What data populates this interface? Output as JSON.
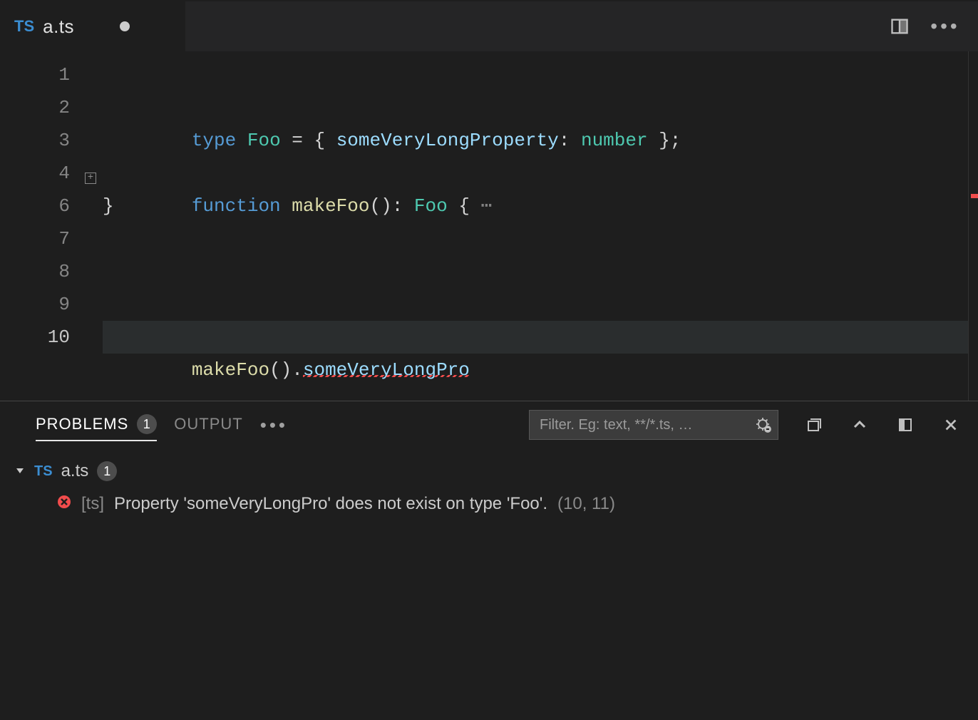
{
  "tabbar": {
    "file_lang_badge": "TS",
    "filename": "a.ts",
    "dirty": true
  },
  "editor": {
    "line_numbers": [
      "1",
      "2",
      "3",
      "4",
      "6",
      "7",
      "8",
      "9",
      "10"
    ],
    "active_line_index": 8,
    "fold_at_index": 3,
    "tokens": {
      "l2_kw": "type",
      "l2_type": "Foo",
      "l2_eq": " = { ",
      "l2_prop": "someVeryLongProperty",
      "l2_colon": ": ",
      "l2_numtype": "number",
      "l2_end": " };",
      "l4_kw": "function",
      "l4_fn": "makeFoo",
      "l4_paren": "(): ",
      "l4_type": "Foo",
      "l4_brace": " {",
      "l4_ellipsis": "⋯",
      "l6_brace": "}",
      "l10_fn": "makeFoo",
      "l10_paren": "().",
      "l10_prop_err": "someVeryLongPro"
    }
  },
  "panel": {
    "problems_label": "PROBLEMS",
    "problems_count": "1",
    "output_label": "OUTPUT",
    "filter_placeholder": "Filter. Eg: text, **/*.ts, …",
    "file_badge": "TS",
    "file_name": "a.ts",
    "file_count": "1",
    "error_source": "[ts]",
    "error_message": "Property 'someVeryLongPro' does not exist on type 'Foo'.",
    "error_location": "(10, 11)"
  }
}
